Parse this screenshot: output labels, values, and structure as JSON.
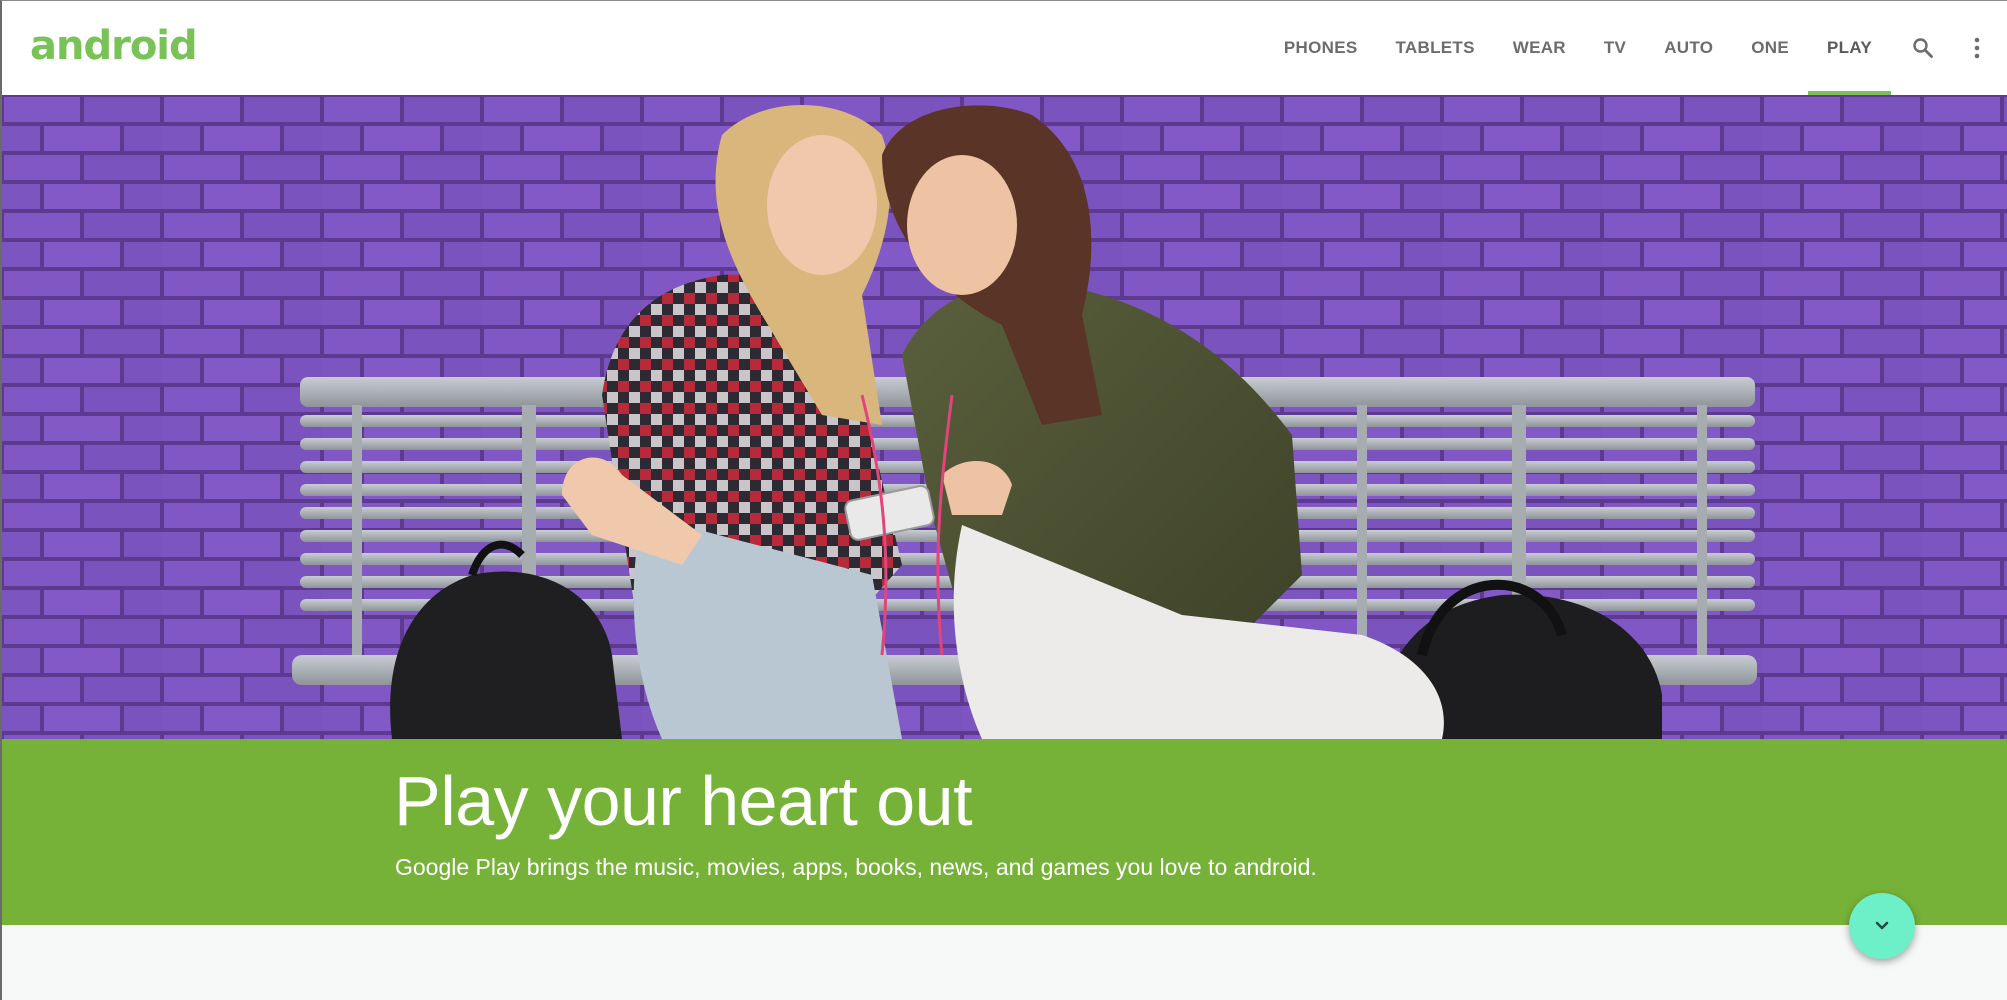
{
  "brand": {
    "logo_text": "android",
    "accent_color": "#78c257"
  },
  "nav": {
    "items": [
      {
        "label": "PHONES",
        "active": false
      },
      {
        "label": "TABLETS",
        "active": false
      },
      {
        "label": "WEAR",
        "active": false
      },
      {
        "label": "TV",
        "active": false
      },
      {
        "label": "AUTO",
        "active": false
      },
      {
        "label": "ONE",
        "active": false
      },
      {
        "label": "PLAY",
        "active": true
      }
    ],
    "icons": [
      "search-icon",
      "more-vert-icon"
    ]
  },
  "hero": {
    "image": "hero-photo"
  },
  "banner": {
    "title": "Play your heart out",
    "subtitle": "Google Play brings the music, movies, apps, books, news, and games you love to android.",
    "background_color": "#76b237"
  },
  "fab": {
    "icon": "chevron-down-icon",
    "color": "#6df0c8"
  }
}
